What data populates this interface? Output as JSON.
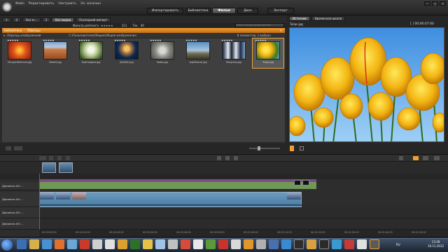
{
  "app": {
    "menus": [
      "Файл",
      "Редактировать",
      "Настроить",
      "Эл. мазазин"
    ]
  },
  "nav": {
    "tabs": [
      "Импортировать",
      "Библиотека",
      "Фильм",
      "Диск",
      "Экспорт"
    ],
    "active": "Фильм"
  },
  "library": {
    "tabs": [
      "1",
      "2",
      "Все м...",
      "3",
      "Все медиа",
      "Последний импорт"
    ],
    "filter_label": "Фильтр рейтинга",
    "count_a": "111",
    "scale_label": "Тек",
    "count_b": "40",
    "search_placeholder": "Найти текущее представление",
    "collection_title": "Библиотека",
    "collection_sub": "Образцы",
    "path": "C:\\Пользователи\\Общие\\Общие изображения",
    "selection_info": "8 элементов, 1 выбран",
    "group_label": "Образцы изображений",
    "items": [
      {
        "name": "Chrysanthemum.jpg",
        "stars": "★★★★★",
        "selected": false
      },
      {
        "name": "Desert.jpg",
        "stars": "★★★★★",
        "selected": false
      },
      {
        "name": "Hydrangeas.jpg",
        "stars": "★★★★★",
        "selected": false
      },
      {
        "name": "Jellyfish.jpg",
        "stars": "★★★★★",
        "selected": false
      },
      {
        "name": "Koala.jpg",
        "stars": "★★★★★",
        "selected": false
      },
      {
        "name": "Lighthouse.jpg",
        "stars": "★★★★★",
        "selected": false
      },
      {
        "name": "Penguins.jpg",
        "stars": "★★★★★",
        "selected": false
      },
      {
        "name": "Tulips.jpg",
        "stars": "★★★★★",
        "selected": true
      }
    ]
  },
  "preview": {
    "tabs": [
      "Источник",
      "Временная шкала"
    ],
    "filename": "Tulips.jpg",
    "timecode": "[ ] 00:00:07:00"
  },
  "timeline": {
    "tracks": [
      "Дорожка A/V ...",
      "Дорожка A/V ...",
      "Дорожка A/V ...",
      "Дорожка A/V ..."
    ],
    "ruler": [
      "00:00:00:00",
      "00:00:10:00",
      "00:00:20:00",
      "00:00:30:00",
      "00:00:40:00",
      "00:00:50:00",
      "00:01:00:00",
      "00:01:10:00",
      "00:01:20:00",
      "00:01:30:00",
      "00:01:40:00",
      "00:01:50:00"
    ]
  },
  "taskbar": {
    "lang": "RU",
    "time": "13:28",
    "date": "10.11.2012"
  },
  "colors": {
    "accent": "#f0a030",
    "bg": "#2a2a2a",
    "clip": "#6a9cc0",
    "audio": "#6f9a55"
  }
}
